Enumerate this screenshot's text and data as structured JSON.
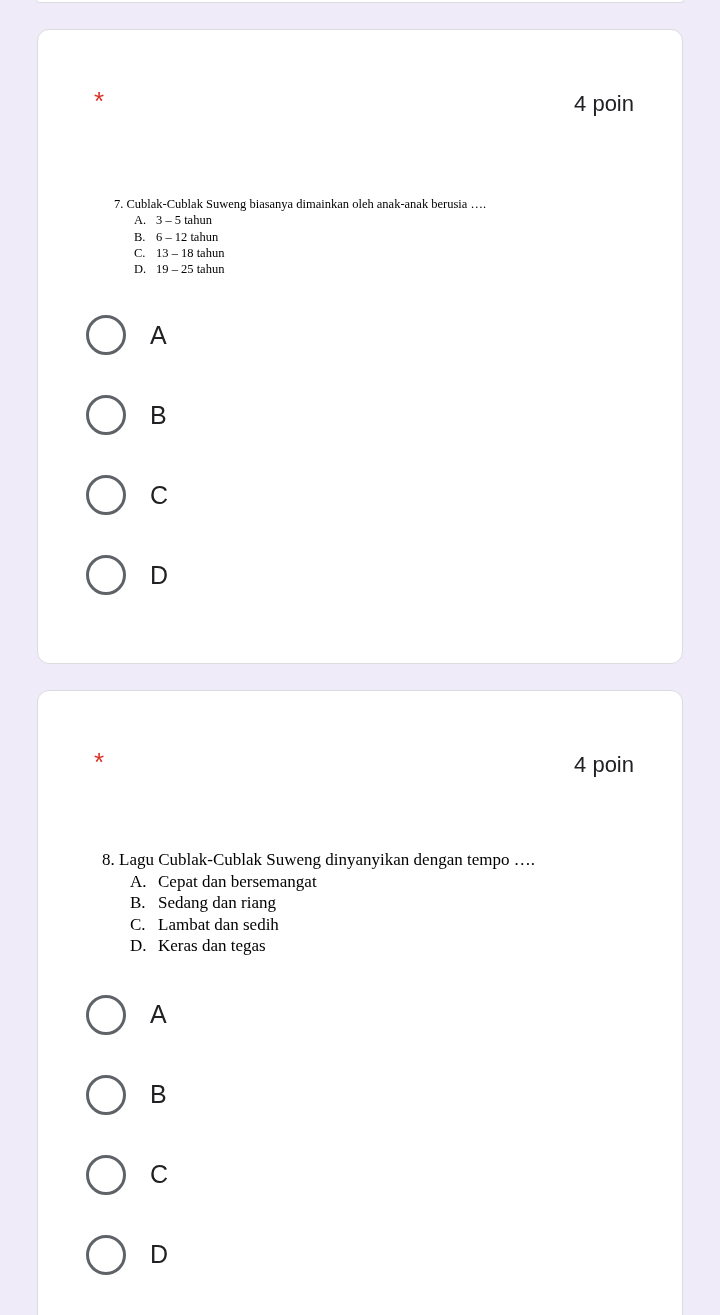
{
  "questions": [
    {
      "required_mark": "*",
      "points": "4 poin",
      "stem": "7. Cublak-Cublak Suweng biasanya dimainkan oleh anak-anak berusia ….",
      "choices": [
        {
          "letter": "A.",
          "text": "3 – 5 tahun"
        },
        {
          "letter": "B.",
          "text": "6 – 12 tahun"
        },
        {
          "letter": "C.",
          "text": "13 – 18 tahun"
        },
        {
          "letter": "D.",
          "text": "19 – 25 tahun"
        }
      ],
      "options": [
        {
          "label": "A",
          "selected": false
        },
        {
          "label": "B",
          "selected": false
        },
        {
          "label": "C",
          "selected": false
        },
        {
          "label": "D",
          "selected": false
        }
      ]
    },
    {
      "required_mark": "*",
      "points": "4 poin",
      "stem": "8. Lagu Cublak-Cublak Suweng dinyanyikan dengan tempo ….",
      "choices": [
        {
          "letter": "A.",
          "text": "Cepat dan bersemangat"
        },
        {
          "letter": "B.",
          "text": "Sedang dan riang"
        },
        {
          "letter": "C.",
          "text": "Lambat dan sedih"
        },
        {
          "letter": "D.",
          "text": "Keras dan tegas"
        }
      ],
      "options": [
        {
          "label": "A",
          "selected": false
        },
        {
          "label": "B",
          "selected": false
        },
        {
          "label": "C",
          "selected": false
        },
        {
          "label": "D",
          "selected": false
        }
      ]
    }
  ]
}
